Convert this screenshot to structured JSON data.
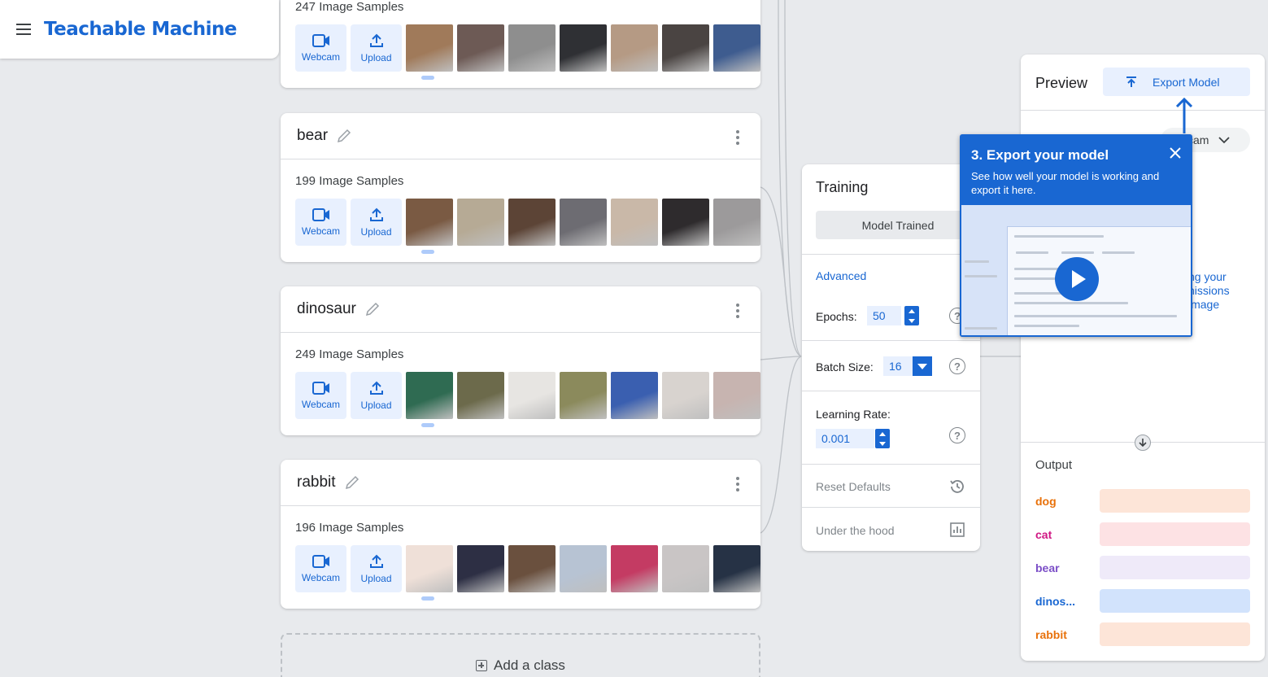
{
  "app": {
    "title": "Teachable Machine"
  },
  "classes": [
    {
      "name": "",
      "samples": "247 Image Samples",
      "webcam": "Webcam",
      "upload": "Upload",
      "thumbs": [
        "#a07a5a",
        "#6d5a55",
        "#8e8e8e",
        "#2f3034",
        "#b59a84",
        "#4a4442",
        "#3e5c8f"
      ]
    },
    {
      "name": "bear",
      "samples": "199 Image Samples",
      "webcam": "Webcam",
      "upload": "Upload",
      "thumbs": [
        "#7a5a43",
        "#b6aa95",
        "#5c4436",
        "#6d6c72",
        "#c9b8a8",
        "#2e2b2d",
        "#9c9a9b"
      ]
    },
    {
      "name": "dinosaur",
      "samples": "249 Image Samples",
      "webcam": "Webcam",
      "upload": "Upload",
      "thumbs": [
        "#2f6b52",
        "#6c6a4b",
        "#e7e5e2",
        "#8b8a5c",
        "#3a5fb0",
        "#d8d3cf",
        "#c7b4b0"
      ]
    },
    {
      "name": "rabbit",
      "samples": "196 Image Samples",
      "webcam": "Webcam",
      "upload": "Upload",
      "thumbs": [
        "#efe0d8",
        "#2d2f44",
        "#6a503e",
        "#b7c3d3",
        "#c43b63",
        "#c9c5c5",
        "#263245"
      ]
    }
  ],
  "add_class": "Add a class",
  "training": {
    "title": "Training",
    "status_button": "Model Trained",
    "advanced": "Advanced",
    "epochs_label": "Epochs:",
    "epochs_value": "50",
    "batch_label": "Batch Size:",
    "batch_value": "16",
    "lr_label": "Learning Rate:",
    "lr_value": "0.001",
    "reset": "Reset Defaults",
    "hood": "Under the hood"
  },
  "preview": {
    "title": "Preview",
    "export": "Export Model",
    "input_source": "cam",
    "hint": [
      "ng your",
      "nissions",
      "image"
    ],
    "output_title": "Output",
    "outputs": [
      {
        "label": "dog",
        "color": "#e8710a",
        "bar": "#fde5d8"
      },
      {
        "label": "cat",
        "color": "#d01884",
        "bar": "#fde2e4"
      },
      {
        "label": "bear",
        "color": "#7b4ec7",
        "bar": "#efeaf9"
      },
      {
        "label": "dinos...",
        "color": "#1967d2",
        "bar": "#d2e3fc"
      },
      {
        "label": "rabbit",
        "color": "#e8710a",
        "bar": "#fde5d8"
      }
    ]
  },
  "tooltip": {
    "title": "3. Export your model",
    "body": "See how well your model is working and export it here."
  },
  "colors": {
    "accent": "#1967d2"
  }
}
